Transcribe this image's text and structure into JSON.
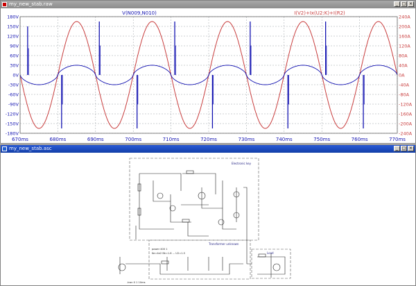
{
  "plot_window": {
    "title": "my_new_stab.raw",
    "trace_left_label": "V(N009,N010)",
    "trace_right_label": "I(V2)+Ix(U2:K)+I(R2)",
    "colors": {
      "left_trace": "#1010b0",
      "right_trace": "#c83c3c",
      "grid": "#9aa0a6"
    }
  },
  "schematic_window": {
    "title": "my_new_stab.asc",
    "block_labels": [
      "Electronic key",
      "Transformer unknown",
      "Load"
    ],
    "note_lines": [
      "power 400 1",
      "Ke=4e2 Bk=1.6 ... U2=1.5",
      ".tran 0 1 10ms"
    ]
  },
  "chart_data": {
    "type": "line",
    "x_unit": "ms",
    "xlim": [
      670,
      770
    ],
    "x_ticks": [
      "670ms",
      "680ms",
      "690ms",
      "700ms",
      "710ms",
      "720ms",
      "730ms",
      "740ms",
      "750ms",
      "760ms",
      "770ms"
    ],
    "y_left_ticks": [
      "180V",
      "150V",
      "120V",
      "90V",
      "60V",
      "30V",
      "0V",
      "-30V",
      "-60V",
      "-90V",
      "-120V",
      "-150V",
      "-180V"
    ],
    "y_right_ticks": [
      "240A",
      "200A",
      "160A",
      "120A",
      "80A",
      "40A",
      "0A",
      "-40A",
      "-80A",
      "-120A",
      "-160A",
      "-200A",
      "-240A"
    ],
    "ylim_left": [
      -180,
      180
    ],
    "ylim_right": [
      -240,
      240
    ],
    "grid": true,
    "series": [
      {
        "name": "V(N009,N010)",
        "axis": "left",
        "shape": "square-like low level with spikes",
        "period_ms": 20,
        "amplitude": 30,
        "spike_times_ms": [
          672,
          681,
          691,
          701,
          711,
          721,
          731,
          741,
          751,
          761
        ],
        "spike_peaks": [
          150,
          -165,
          165,
          -165,
          165,
          -165,
          165,
          -165,
          165,
          -165
        ]
      },
      {
        "name": "I(V2)+Ix(U2:K)+I(R2)",
        "axis": "right",
        "shape": "sine",
        "period_ms": 20,
        "amplitude": 220,
        "phase_zero_ms": 680
      }
    ]
  }
}
